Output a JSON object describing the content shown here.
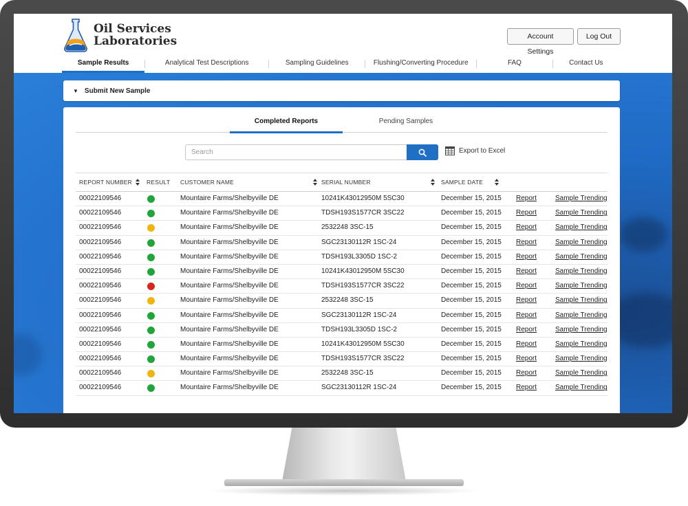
{
  "brand": {
    "name_line1": "Oil Services",
    "name_line2": "Laboratories"
  },
  "header": {
    "account_settings": "Account Settings",
    "log_out": "Log Out"
  },
  "nav": [
    {
      "label": "Sample Results",
      "active": true
    },
    {
      "label": "Analytical Test Descriptions",
      "active": false
    },
    {
      "label": "Sampling Guidelines",
      "active": false
    },
    {
      "label": "Flushing/Converting Procedure",
      "active": false
    },
    {
      "label": "FAQ",
      "active": false
    },
    {
      "label": "Contact Us",
      "active": false
    }
  ],
  "submit_bar": {
    "label": "Submit New Sample"
  },
  "tabs": [
    {
      "label": "Completed Reports",
      "active": true
    },
    {
      "label": "Pending Samples",
      "active": false
    }
  ],
  "search": {
    "placeholder": "Search",
    "value": ""
  },
  "export": {
    "label": "Export to Excel"
  },
  "colors": {
    "accent": "#1f6fc5",
    "status_green": "#1fa53a",
    "status_yellow": "#f2b410",
    "status_red": "#d8261c"
  },
  "table": {
    "columns": [
      "REPORT NUMBER",
      "RESULT",
      "CUSTOMER NAME",
      "SERIAL NUMBER",
      "SAMPLE DATE"
    ],
    "rows": [
      {
        "report": "00022109546",
        "result": "green",
        "customer": "Mountaire Farms/Shelbyville DE",
        "serial": "10241K43012950M 5SC30",
        "date": "December 15, 2015",
        "report_link": "Report",
        "trend_link": "Sample Trending"
      },
      {
        "report": "00022109546",
        "result": "green",
        "customer": "Mountaire Farms/Shelbyville DE",
        "serial": "TDSH193S1577CR 3SC22",
        "date": "December 15, 2015",
        "report_link": "Report",
        "trend_link": "Sample Trending"
      },
      {
        "report": "00022109546",
        "result": "yellow",
        "customer": "Mountaire Farms/Shelbyville DE",
        "serial": "2532248 3SC-15",
        "date": "December 15, 2015",
        "report_link": "Report",
        "trend_link": "Sample Trending"
      },
      {
        "report": "00022109546",
        "result": "green",
        "customer": "Mountaire Farms/Shelbyville DE",
        "serial": "SGC23130112R 1SC-24",
        "date": "December 15, 2015",
        "report_link": "Report",
        "trend_link": "Sample Trending"
      },
      {
        "report": "00022109546",
        "result": "green",
        "customer": "Mountaire Farms/Shelbyville DE",
        "serial": "TDSH193L3305D 1SC-2",
        "date": "December 15, 2015",
        "report_link": "Report",
        "trend_link": "Sample Trending"
      },
      {
        "report": "00022109546",
        "result": "green",
        "customer": "Mountaire Farms/Shelbyville DE",
        "serial": "10241K43012950M 5SC30",
        "date": "December 15, 2015",
        "report_link": "Report",
        "trend_link": "Sample Trending"
      },
      {
        "report": "00022109546",
        "result": "red",
        "customer": "Mountaire Farms/Shelbyville DE",
        "serial": "TDSH193S1577CR 3SC22",
        "date": "December 15, 2015",
        "report_link": "Report",
        "trend_link": "Sample Trending"
      },
      {
        "report": "00022109546",
        "result": "yellow",
        "customer": "Mountaire Farms/Shelbyville DE",
        "serial": "2532248 3SC-15",
        "date": "December 15, 2015",
        "report_link": "Report",
        "trend_link": "Sample Trending"
      },
      {
        "report": "00022109546",
        "result": "green",
        "customer": "Mountaire Farms/Shelbyville DE",
        "serial": "SGC23130112R 1SC-24",
        "date": "December 15, 2015",
        "report_link": "Report",
        "trend_link": "Sample Trending"
      },
      {
        "report": "00022109546",
        "result": "green",
        "customer": "Mountaire Farms/Shelbyville DE",
        "serial": "TDSH193L3305D 1SC-2",
        "date": "December 15, 2015",
        "report_link": "Report",
        "trend_link": "Sample Trending"
      },
      {
        "report": "00022109546",
        "result": "green",
        "customer": "Mountaire Farms/Shelbyville DE",
        "serial": "10241K43012950M 5SC30",
        "date": "December 15, 2015",
        "report_link": "Report",
        "trend_link": "Sample Trending"
      },
      {
        "report": "00022109546",
        "result": "green",
        "customer": "Mountaire Farms/Shelbyville DE",
        "serial": "TDSH193S1577CR 3SC22",
        "date": "December 15, 2015",
        "report_link": "Report",
        "trend_link": "Sample Trending"
      },
      {
        "report": "00022109546",
        "result": "yellow",
        "customer": "Mountaire Farms/Shelbyville DE",
        "serial": "2532248 3SC-15",
        "date": "December 15, 2015",
        "report_link": "Report",
        "trend_link": "Sample Trending"
      },
      {
        "report": "00022109546",
        "result": "green",
        "customer": "Mountaire Farms/Shelbyville DE",
        "serial": "SGC23130112R 1SC-24",
        "date": "December 15, 2015",
        "report_link": "Report",
        "trend_link": "Sample Trending"
      }
    ]
  }
}
